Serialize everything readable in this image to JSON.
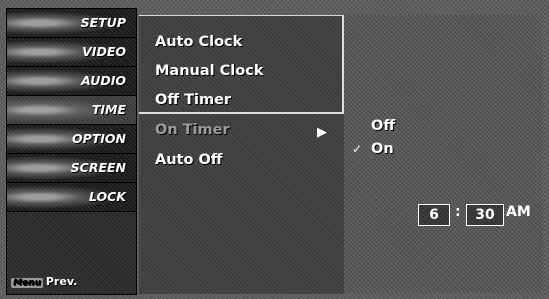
{
  "nav": {
    "items": [
      {
        "label": "SETUP",
        "icon": "setup-icon"
      },
      {
        "label": "VIDEO",
        "icon": "video-icon"
      },
      {
        "label": "AUDIO",
        "icon": "audio-icon"
      },
      {
        "label": "TIME",
        "icon": "time-icon"
      },
      {
        "label": "OPTION",
        "icon": "option-icon"
      },
      {
        "label": "SCREEN",
        "icon": "screen-icon"
      },
      {
        "label": "LOCK",
        "icon": "lock-icon"
      }
    ],
    "active": "TIME",
    "footer_key": "Menu",
    "footer_label": "Prev."
  },
  "menu": {
    "items": [
      "Auto Clock",
      "Manual Clock",
      "Off Timer",
      "On Timer",
      "Auto Off"
    ],
    "selected": "On Timer",
    "arrow": "▶"
  },
  "panel": {
    "options": [
      "Off",
      "On"
    ],
    "checked": "On",
    "check_mark": "✓",
    "hour": "6",
    "separator": ":",
    "minute": "30",
    "period": "AM"
  }
}
